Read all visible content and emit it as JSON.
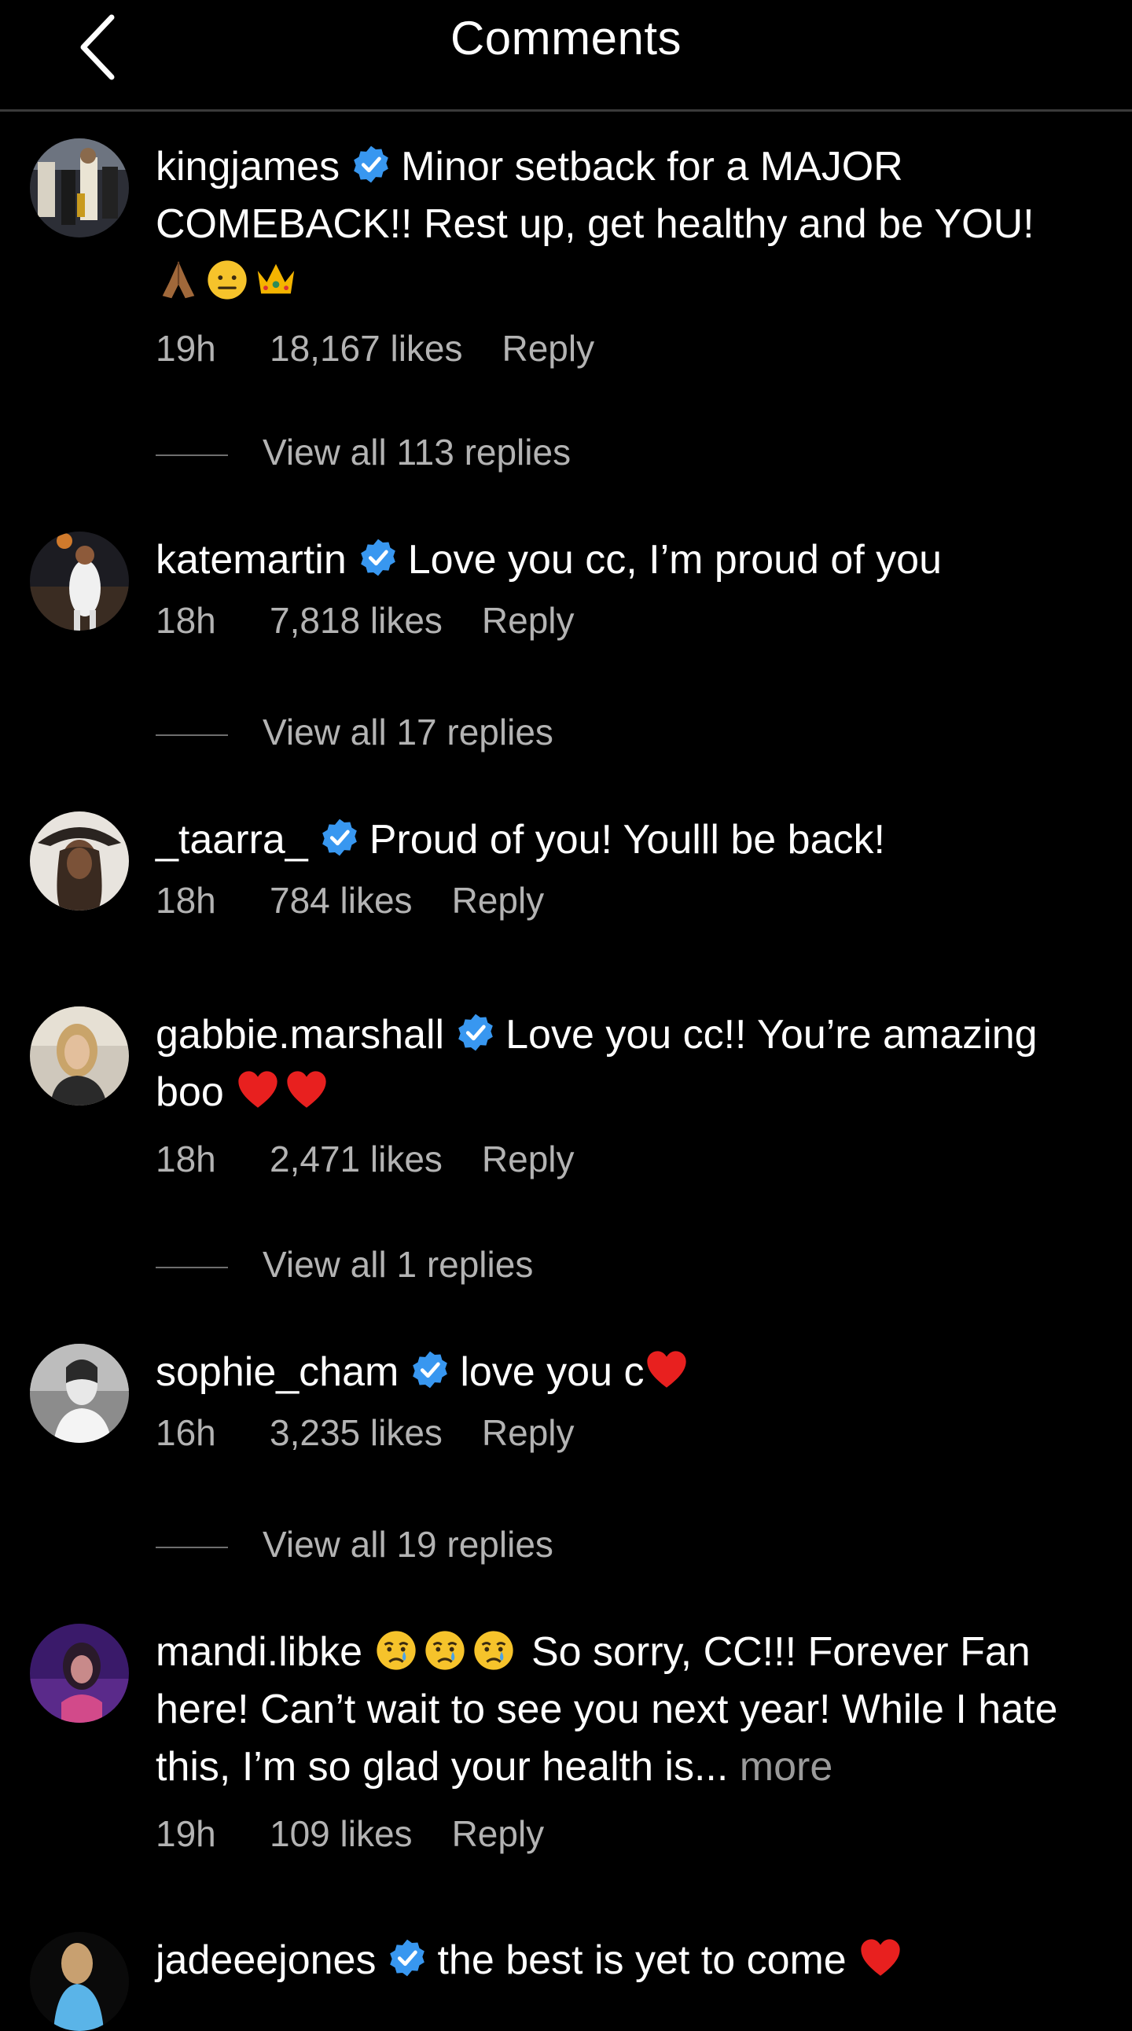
{
  "header": {
    "title": "Comments"
  },
  "comments": [
    {
      "username": "kingjames",
      "text": "Minor setback for a MAJOR COMEBACK!! Rest up, get healthy and be YOU!",
      "emojis": [
        "folded-hands-emoji",
        "salute-emoji",
        "crown-emoji"
      ],
      "time": "19h",
      "likes": "18,167 likes",
      "reply": "Reply",
      "view_replies": "View all 113 replies"
    },
    {
      "username": "katemartin",
      "text": "Love you cc, I’m proud of you",
      "time": "18h",
      "likes": "7,818 likes",
      "reply": "Reply",
      "view_replies": "View all 17 replies"
    },
    {
      "username": "_taarra_",
      "text": "Proud of you! Youlll be back!",
      "time": "18h",
      "likes": "784 likes",
      "reply": "Reply"
    },
    {
      "username": "gabbie.marshall",
      "text": "Love you cc!! You’re amazing boo",
      "emojis": [
        "red-heart-emoji",
        "red-heart-emoji"
      ],
      "time": "18h",
      "likes": "2,471 likes",
      "reply": "Reply",
      "view_replies": "View all 1 replies"
    },
    {
      "username": "sophie_cham",
      "text": "love you c",
      "emojis": [
        "red-heart-emoji"
      ],
      "time": "16h",
      "likes": "3,235 likes",
      "reply": "Reply",
      "view_replies": "View all 19 replies"
    },
    {
      "username": "mandi.libke",
      "text": "So sorry, CC!!! Forever Fan here! Can’t wait to see you next year! While I hate this, I’m so glad your health is...",
      "more": "more",
      "emojis": [
        "crying-face-emoji",
        "crying-face-emoji",
        "crying-face-emoji"
      ],
      "time": "19h",
      "likes": "109 likes",
      "reply": "Reply"
    },
    {
      "username": "jadeeejones",
      "text": "the best is yet to come",
      "emojis": [
        "red-heart-emoji"
      ]
    }
  ],
  "colors": {
    "background": "#000000",
    "verified_badge": "#3897f0",
    "secondary_text": "#b3b3b3",
    "heart": "#e8201f"
  }
}
